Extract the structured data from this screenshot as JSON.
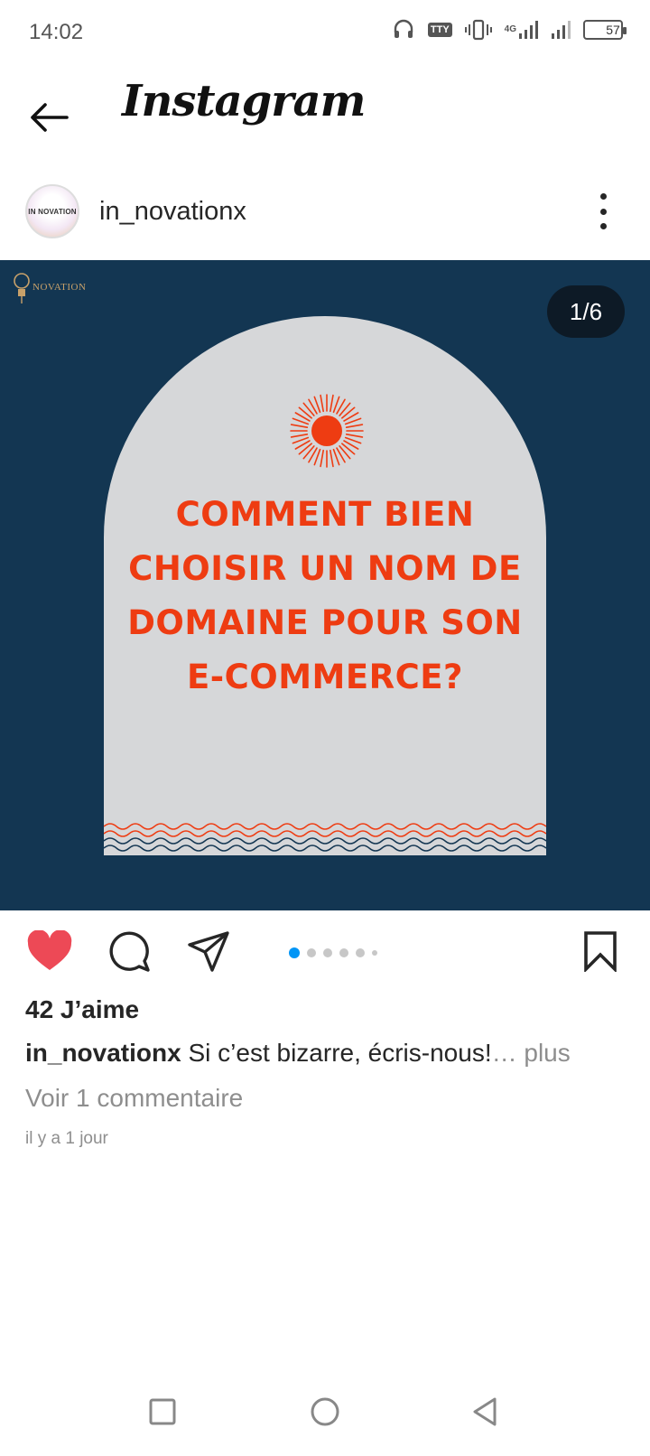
{
  "status_bar": {
    "time": "14:02",
    "tty_label": "TTY",
    "network_label": "4G",
    "battery_level": "57",
    "icons": [
      "headset-icon",
      "tty-icon",
      "vibrate-icon",
      "signal-4g-icon",
      "signal-icon",
      "battery-icon"
    ]
  },
  "header": {
    "title": "Instagram",
    "back_icon": "arrow-left-icon"
  },
  "post": {
    "username": "in_novationx",
    "avatar_text": "IN NOVATION",
    "brand_mark": "NOVATION",
    "slide_counter": "1/6",
    "slide_count": 6,
    "current_slide": 1,
    "headline_lines": [
      "COMMENT BIEN",
      "CHOISIR UN NOM DE",
      "DOMAINE POUR SON",
      "E-COMMERCE?"
    ],
    "likes": "42 J’aime",
    "caption_user": "in_novationx",
    "caption_text": " Si c’est bizarre, écris-nous!",
    "caption_more": "… plus",
    "comments_link": "Voir 1 commentaire",
    "timestamp": "il y a 1 jour",
    "liked": true
  },
  "actions": {
    "like_icon": "heart-icon",
    "comment_icon": "comment-icon",
    "share_icon": "paper-plane-icon",
    "save_icon": "bookmark-icon"
  },
  "navbar": {
    "items": [
      "recents-icon",
      "home-icon",
      "back-icon"
    ]
  },
  "colors": {
    "post_background": "#133652",
    "arch_fill": "#d6d7d9",
    "headline": "#ee3c12",
    "like_red": "#ed4956",
    "active_dot": "#0095f6"
  }
}
